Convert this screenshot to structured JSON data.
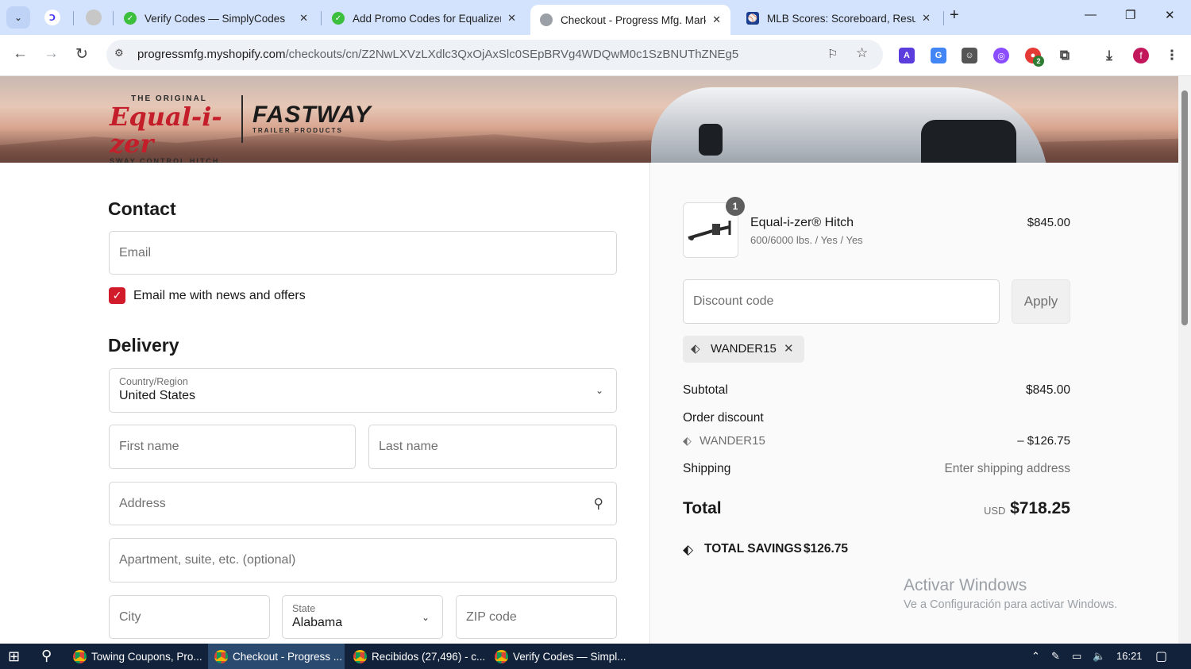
{
  "browser": {
    "tabs": [
      {
        "title": "Verify Codes — SimplyCodes"
      },
      {
        "title": "Add Promo Codes for Equalizer"
      },
      {
        "title": "Checkout - Progress Mfg. Marke"
      },
      {
        "title": "MLB Scores: Scoreboard, Results"
      }
    ],
    "url_host": "progressmfg.myshopify.com",
    "url_path": "/checkouts/cn/Z2NwLXVzLXdlc3QxOjAxSlc0SEpBRVg4WDQwM0c1SzBNUThZNEg5",
    "profile_initial": "f",
    "ext_badge": "2"
  },
  "banner": {
    "logo1_top": "THE ORIGINAL",
    "logo1_main": "Equal-i-zer",
    "logo1_bottom": "SWAY CONTROL HITCH",
    "logo2_main": "FASTWAY",
    "logo2_sub": "TRAILER PRODUCTS"
  },
  "contact": {
    "heading": "Contact",
    "email_placeholder": "Email",
    "newsletter_label": "Email me with news and offers",
    "newsletter_checked": true
  },
  "delivery": {
    "heading": "Delivery",
    "country_label": "Country/Region",
    "country_value": "United States",
    "first_name_placeholder": "First name",
    "last_name_placeholder": "Last name",
    "address_placeholder": "Address",
    "apartment_placeholder": "Apartment, suite, etc. (optional)",
    "city_placeholder": "City",
    "state_label": "State",
    "state_value": "Alabama",
    "zip_placeholder": "ZIP code"
  },
  "summary": {
    "item": {
      "quantity": "1",
      "name": "Equal-i-zer® Hitch",
      "variant": "600/6000 lbs. / Yes / Yes",
      "price": "$845.00"
    },
    "discount_placeholder": "Discount code",
    "apply_label": "Apply",
    "applied_code": "WANDER15",
    "subtotal_label": "Subtotal",
    "subtotal_value": "$845.00",
    "order_discount_label": "Order discount",
    "discount_code": "WANDER15",
    "discount_value": "– $126.75",
    "shipping_label": "Shipping",
    "shipping_value": "Enter shipping address",
    "total_label": "Total",
    "currency": "USD",
    "total_value": "$718.25",
    "savings_label": "TOTAL SAVINGS",
    "savings_value": "$126.75"
  },
  "watermark": {
    "title": "Activar Windows",
    "subtitle": "Ve a Configuración para activar Windows."
  },
  "taskbar": {
    "items": [
      {
        "label": "Towing Coupons, Pro..."
      },
      {
        "label": "Checkout - Progress ..."
      },
      {
        "label": "Recibidos (27,496) - c..."
      },
      {
        "label": "Verify Codes — Simpl..."
      }
    ],
    "time": "16:21"
  }
}
